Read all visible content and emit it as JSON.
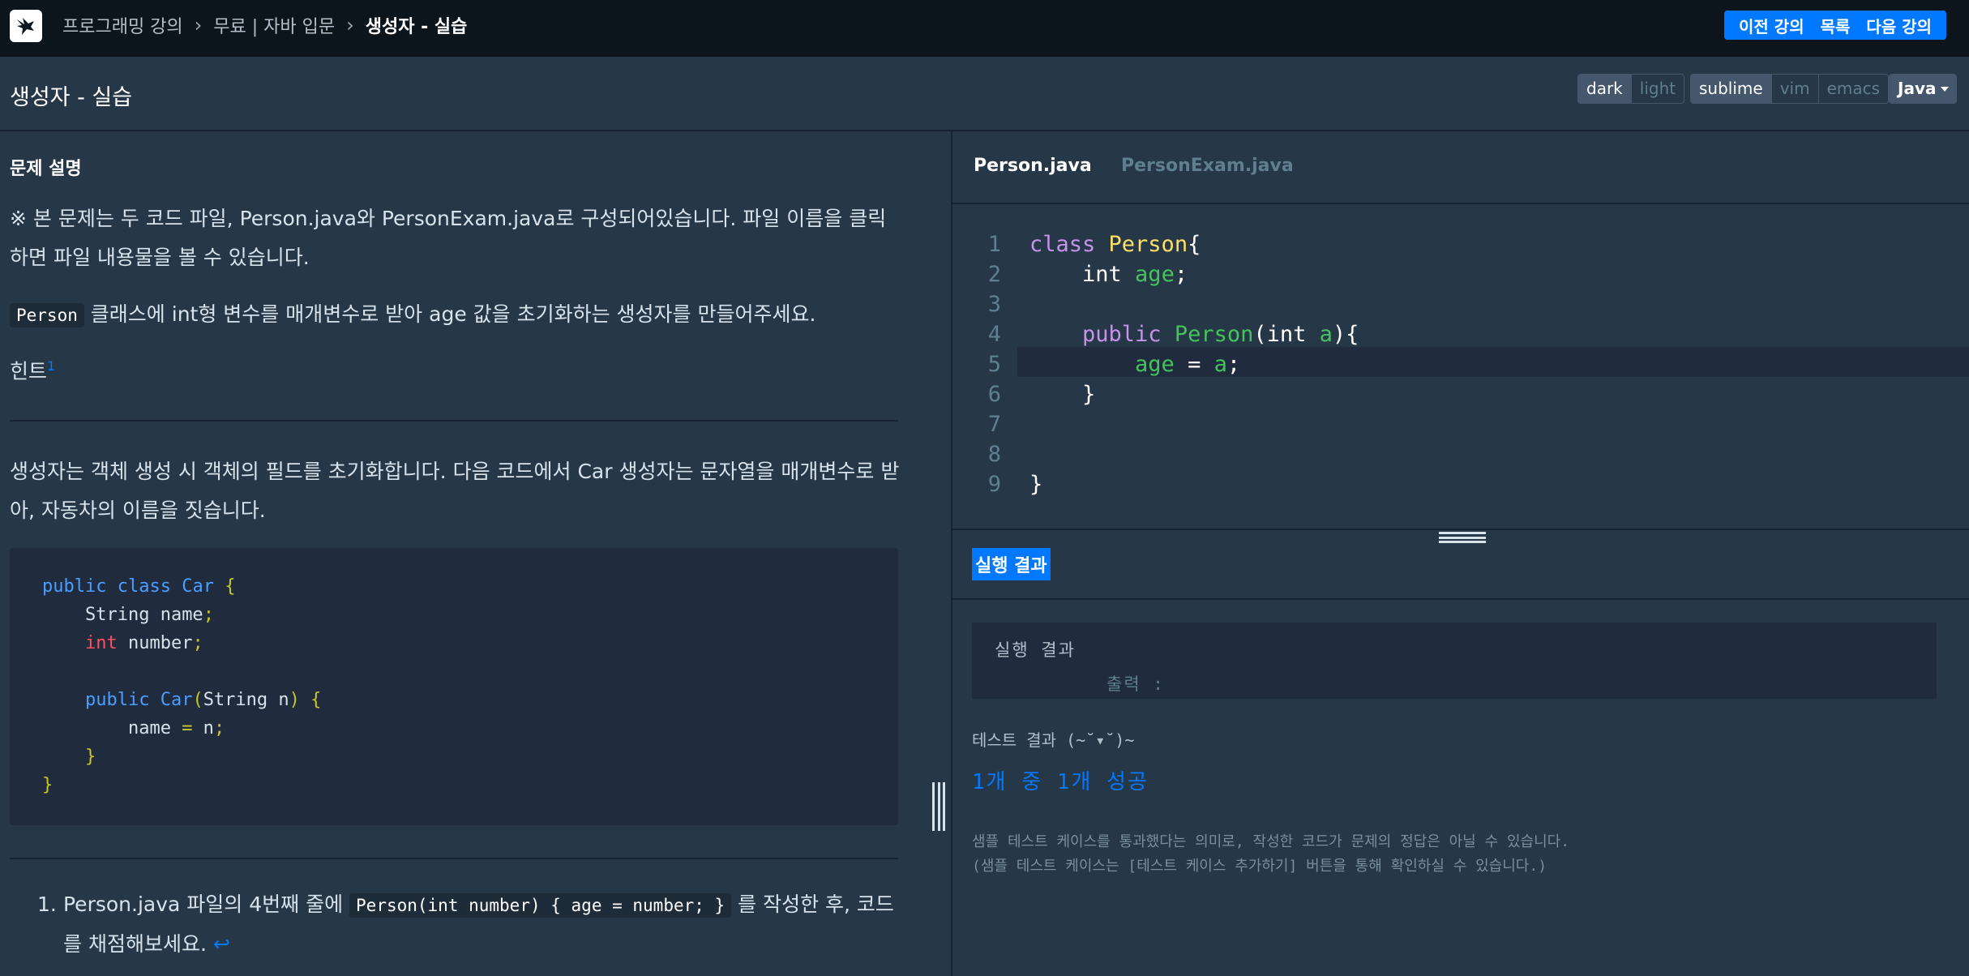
{
  "topbar": {
    "breadcrumb": [
      "프로그래밍 강의",
      "무료 | 자바 입문",
      "생성자 - 실습"
    ],
    "prev_label": "이전 강의",
    "list_label": "목록",
    "next_label": "다음 강의"
  },
  "titlebar": {
    "title": "생성자 - 실습",
    "themes": [
      "dark",
      "light"
    ],
    "active_theme": "dark",
    "keymaps": [
      "sublime",
      "vim",
      "emacs"
    ],
    "active_keymap": "sublime",
    "language": "Java"
  },
  "problem": {
    "section_title": "문제 설명",
    "p1": "※ 본 문제는 두 코드 파일, Person.java와 PersonExam.java로 구성되어있습니다. 파일 이름을 클릭하면 파일 내용물을 볼 수 있습니다.",
    "p2_code": "Person",
    "p2_text": " 클래스에 int형 변수를 매개변수로 받아 age 값을 초기화하는 생성자를 만들어주세요.",
    "hint_label": "힌트",
    "hint_sup": "1",
    "p3": "생성자는 객체 생성 시 객체의 필드를 초기화합니다. 다음 코드에서 Car 생성자는 문자열을 매개변수로 받아, 자동차의 이름을 짓습니다.",
    "footnote_num": "1.",
    "footnote_pre": "Person.java 파일의 4번째 줄에 ",
    "footnote_code": "Person(int number) { age = number; }",
    "footnote_post": " 를 작성한 후, 코드를 채점해보세요.",
    "footnote_arrow": "↩"
  },
  "example_code": {
    "l1_kw": "public class",
    "l1_name": " Car ",
    "l1_brace": "{",
    "l2_type": "    String",
    " l2_name": "",
    "l2_text": " name",
    "l2_semi": ";",
    "l3_type": "    int",
    "l3_text": " number",
    "l3_semi": ";",
    "l5_kw": "    public",
    "l5_name": " Car",
    "l5_paren": "(",
    "l5_args": "String n",
    "l5_paren2": ")",
    "l5_brace": " {",
    "l6_text": "        name ",
    "l6_eq": "=",
    "l6_val": " n",
    "l6_semi": ";",
    "l7": "    }",
    "l8": "}"
  },
  "editor": {
    "tabs": [
      "Person.java",
      "PersonExam.java"
    ],
    "active_tab": "Person.java",
    "line_numbers": [
      "1",
      "2",
      "3",
      "4",
      "5",
      "6",
      "7",
      "8",
      "9"
    ],
    "code": {
      "l1_kw": "class",
      "l1_cls": " Person",
      "l1_brace": "{",
      "l2_type": "    int",
      "l2_id": " age",
      "l2_semi": ";",
      "l4_kw": "    public",
      "l4_cls": " Person",
      "l4_open": "(int ",
      "l4_id": "a",
      "l4_close": "){",
      "l5_id": "        age",
      "l5_eq": " = ",
      "l5_val": "a",
      "l5_semi": ";",
      "l6": "    }",
      "l9": "}"
    }
  },
  "result": {
    "title": "실행 결과",
    "box_title": "실행 결과",
    "box_output": "출력 :",
    "test_label": "테스트 결과 (~˘▾˘)~",
    "test_result": "1개 중 1개 성공",
    "note1": "샘플 테스트 케이스를 통과했다는 의미로, 작성한 코드가 문제의 정답은 아닐 수 있습니다.",
    "note2": "(샘플 테스트 케이스는 [테스트 케이스 추가하기] 버튼을 통해 확인하실 수 있습니다.)"
  }
}
